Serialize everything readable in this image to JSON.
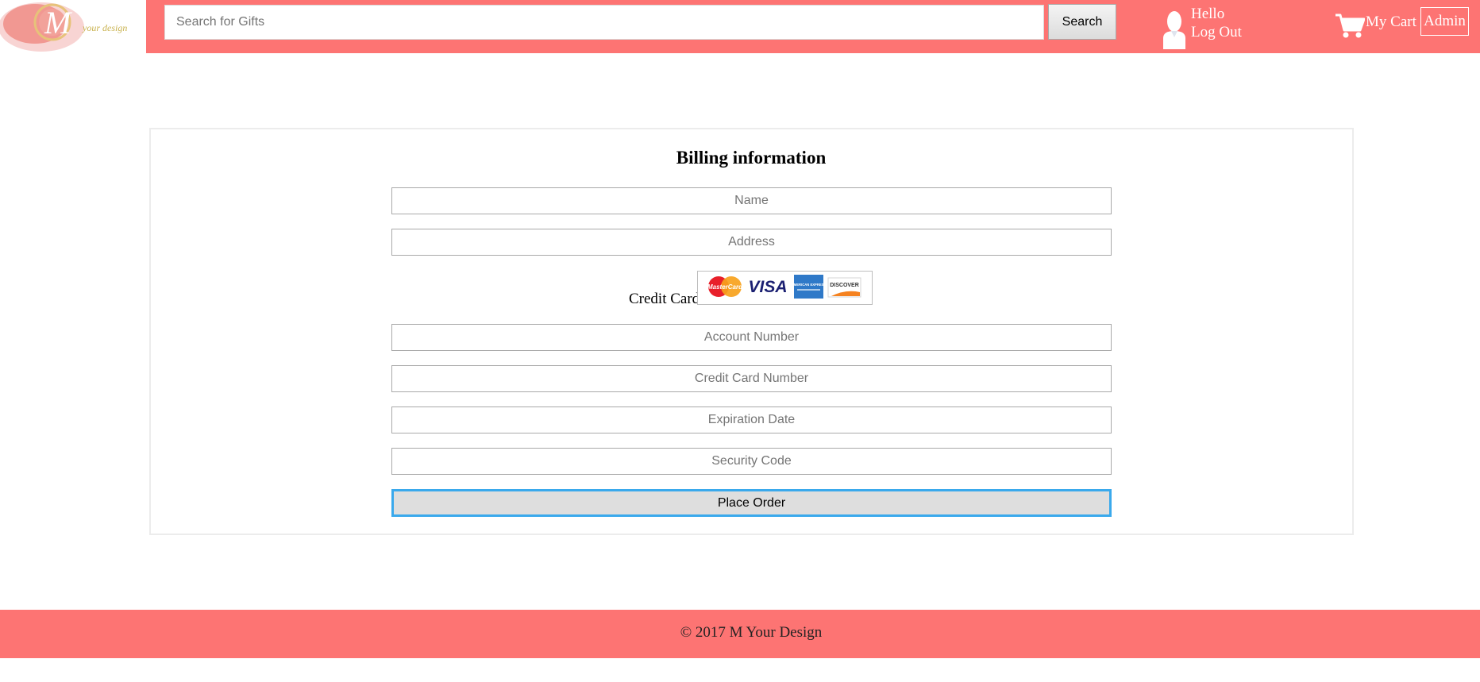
{
  "brand": {
    "logo_letter": "M",
    "logo_tagline": "your design",
    "accent_color": "#fd7473"
  },
  "header": {
    "search_placeholder": "Search for Gifts",
    "search_button": "Search",
    "user_icon": "user-silhouette-icon",
    "greeting": "Hello",
    "logout": "Log Out",
    "cart_icon": "shopping-cart-icon",
    "cart_label": "My Cart",
    "admin_label": "Admin"
  },
  "billing": {
    "title": "Billing information",
    "name_placeholder": "Name",
    "address_placeholder": "Address",
    "credit_card_label": "Credit Card",
    "card_brands": [
      "MasterCard",
      "VISA",
      "AMERICAN EXPRESS",
      "DISCOVER"
    ],
    "account_number_placeholder": "Account Number",
    "card_number_placeholder": "Credit Card Number",
    "expiration_placeholder": "Expiration Date",
    "security_code_placeholder": "Security Code",
    "place_order_label": "Place Order",
    "place_order_focus_color": "#3aa9ec"
  },
  "footer": {
    "copyright": "© 2017 M Your Design"
  }
}
